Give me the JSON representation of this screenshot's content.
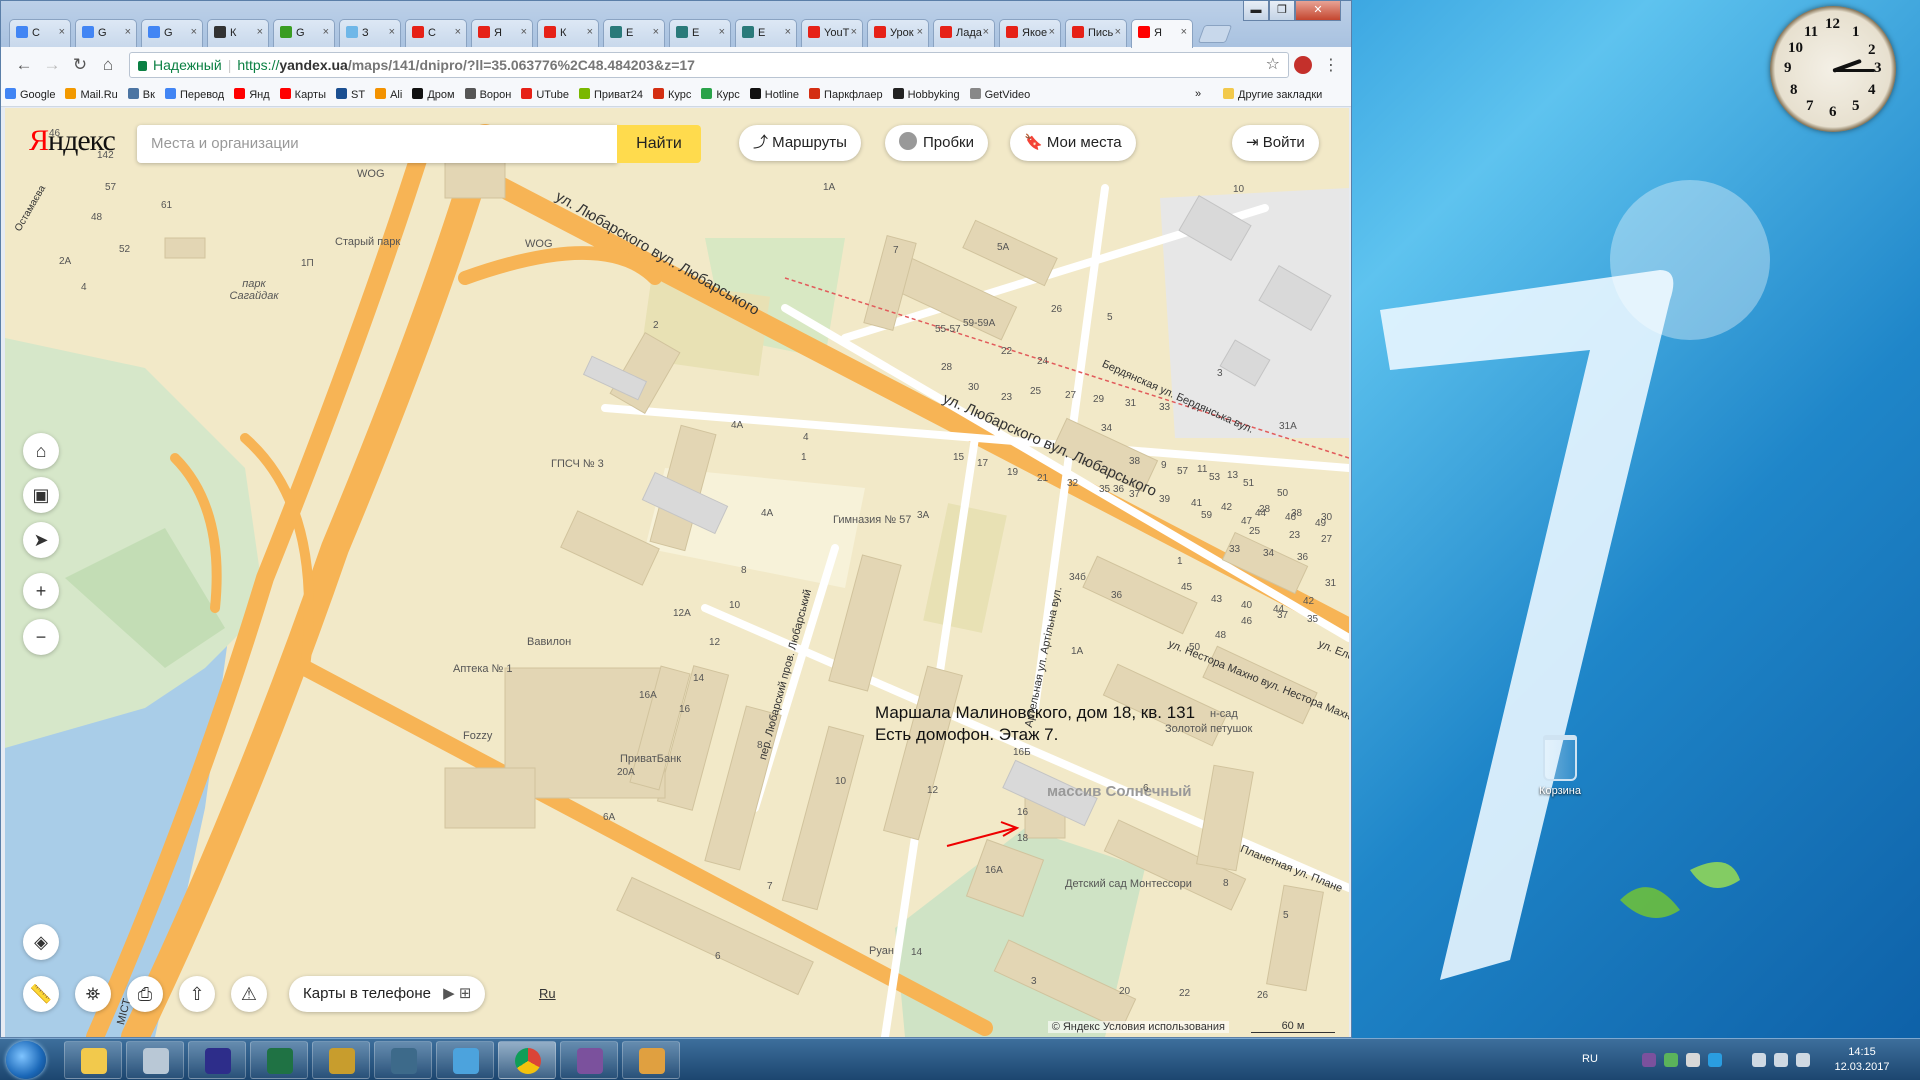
{
  "browser": {
    "tabs": [
      {
        "label": "С",
        "color": "#4285f4"
      },
      {
        "label": "G",
        "color": "#4285f4"
      },
      {
        "label": "G",
        "color": "#4285f4"
      },
      {
        "label": "К",
        "color": "#333"
      },
      {
        "label": "G",
        "color": "#3a9d23"
      },
      {
        "label": "З",
        "color": "#6fb7e8"
      },
      {
        "label": "С",
        "color": "#e62117"
      },
      {
        "label": "Я",
        "color": "#e62117"
      },
      {
        "label": "К",
        "color": "#e62117"
      },
      {
        "label": "Е",
        "color": "#2a7a7a"
      },
      {
        "label": "Е",
        "color": "#2a7a7a"
      },
      {
        "label": "Е",
        "color": "#2a7a7a"
      },
      {
        "label": "YouT",
        "color": "#e62117"
      },
      {
        "label": "Урок",
        "color": "#e62117"
      },
      {
        "label": "Лада",
        "color": "#e62117"
      },
      {
        "label": "Якое",
        "color": "#e62117"
      },
      {
        "label": "Пись",
        "color": "#e62117"
      },
      {
        "label": "Я",
        "color": "#f00"
      }
    ],
    "window_buttons": {
      "minimize": "▬",
      "maximize": "❐",
      "close": "✕"
    },
    "nav": {
      "back": "←",
      "forward": "→",
      "reload": "↻",
      "home": "⌂"
    },
    "address": {
      "secure_label": "Надежный",
      "scheme": "https://",
      "host": "yandex.ua",
      "path": "/maps/141/dnipro/?ll=35.063776%2C48.484203&z=17"
    },
    "bookmarks": [
      {
        "label": "Google",
        "color": "#4285f4"
      },
      {
        "label": "Mail.Ru",
        "color": "#f29900"
      },
      {
        "label": "Вк",
        "color": "#4c75a3"
      },
      {
        "label": "Перевод",
        "color": "#4285f4"
      },
      {
        "label": "Янд",
        "color": "#f00"
      },
      {
        "label": "Карты",
        "color": "#f00"
      },
      {
        "label": "ST",
        "color": "#1b4f91"
      },
      {
        "label": "Ali",
        "color": "#f39200"
      },
      {
        "label": "Дром",
        "color": "#111"
      },
      {
        "label": "Ворон",
        "color": "#555"
      },
      {
        "label": "UTube",
        "color": "#e62117"
      },
      {
        "label": "Приват24",
        "color": "#7ab800"
      },
      {
        "label": "Курс",
        "color": "#d42e12"
      },
      {
        "label": "Курс",
        "color": "#2aa34a"
      },
      {
        "label": "Hotline",
        "color": "#111"
      },
      {
        "label": "Паркфлаер",
        "color": "#d42e12"
      },
      {
        "label": "Hobbyking",
        "color": "#222"
      },
      {
        "label": "GetVideo",
        "color": "#888"
      }
    ],
    "bookmarks_more": "»",
    "other_bookmarks": "Другие закладки"
  },
  "map": {
    "logo": {
      "first": "Я",
      "rest": "ндекс"
    },
    "search_placeholder": "Места и организации",
    "find_button": "Найти",
    "routes_button": "Маршруты",
    "traffic_button": "Пробки",
    "my_places_button": "Мои места",
    "login_button": "Войти",
    "phone_button": "Карты в телефоне",
    "ru_link": "Ru",
    "annotation_line1": "Маршала Малиновского, дом 18, кв. 131",
    "annotation_line2": "Есть домофон. Этаж 7.",
    "copyright": "© Яндекс Условия использования",
    "scale": "60 м",
    "streets": {
      "lyubarskogo1": "ул. Любарского вул. Любарського",
      "lyubarskogo2": "ул. Любарского вул. Любарського",
      "berdyanskaya": "Бердянская ул. Бердянська вул.",
      "artelnaya": "Артельная ул. Артільна вул.",
      "lyubarskiy_per": "пер. Любарский пров. Любарський",
      "makhno": "ул. Нестора Махно вул. Нестора Махно",
      "planetnaya": "Планетная ул. Плане",
      "ostamaeva": "Остамаєва",
      "elena": "ул. Еле",
      "most": "МІСТ"
    },
    "pois": {
      "wog1": "WOG",
      "wog2": "WOG",
      "stary_park": "Старый парк",
      "park": "парк Сагайдак",
      "gpsch": "ГПСЧ № 3",
      "gymnasium": "Гимназия № 57",
      "vavilon": "Вавилон",
      "apteka": "Аптека № 1",
      "fozzy": "Fozzy",
      "privat": "ПриватБанк",
      "zolotoy": "Золотой петушок",
      "kindergarten_label": "н-сад",
      "massiv": "массив Солнечный",
      "montessori": "Детский сад Монтессори",
      "ruan": "Руан"
    },
    "house_numbers": [
      "142",
      "46",
      "57",
      "61",
      "48",
      "52",
      "2А",
      "4",
      "1П",
      "1А",
      "7",
      "5А",
      "10",
      "5",
      "2",
      "4А",
      "4",
      "1",
      "4А",
      "3А",
      "8",
      "10",
      "12А",
      "12",
      "14",
      "16",
      "16А",
      "20А",
      "6А",
      "8",
      "10",
      "12",
      "16Б",
      "18",
      "16А",
      "16",
      "14",
      "6",
      "7",
      "6",
      "8",
      "5",
      "3",
      "20",
      "22",
      "26",
      "34б",
      "36",
      "1А",
      "1",
      "3",
      "31А",
      "55-57",
      "59-59А",
      "22",
      "24",
      "26",
      "28",
      "30",
      "23",
      "25",
      "27",
      "29",
      "31",
      "33",
      "34",
      "36",
      "38",
      "9",
      "11",
      "13",
      "15",
      "17",
      "19",
      "21",
      "32",
      "35",
      "37",
      "39",
      "41",
      "42",
      "44",
      "46",
      "49",
      "50",
      "51",
      "53",
      "57",
      "59",
      "47",
      "45",
      "43",
      "40",
      "37",
      "35",
      "33",
      "34",
      "36",
      "28",
      "38",
      "30",
      "25",
      "23",
      "27",
      "31",
      "42",
      "44",
      "46",
      "48",
      "50"
    ]
  },
  "desktop": {
    "clock_numbers": [
      "12",
      "1",
      "2",
      "3",
      "4",
      "5",
      "6",
      "7",
      "8",
      "9",
      "10",
      "11"
    ],
    "recycle_bin": "Корзина"
  },
  "taskbar": {
    "apps": [
      {
        "name": "explorer",
        "color": "#f2c94c"
      },
      {
        "name": "calculator",
        "color": "#b9c8d6"
      },
      {
        "name": "save",
        "color": "#2d2d8a"
      },
      {
        "name": "excel-v",
        "color": "#1f7244"
      },
      {
        "name": "font-a",
        "color": "#c89d2d"
      },
      {
        "name": "monitor",
        "color": "#3d6a8a"
      },
      {
        "name": "box",
        "color": "#4ca3dd"
      },
      {
        "name": "chrome",
        "color": "#db4437"
      },
      {
        "name": "viber",
        "color": "#7b519d"
      },
      {
        "name": "paint",
        "color": "#e0a040"
      }
    ],
    "language": "RU",
    "time": "14:15",
    "date": "12.03.2017"
  }
}
